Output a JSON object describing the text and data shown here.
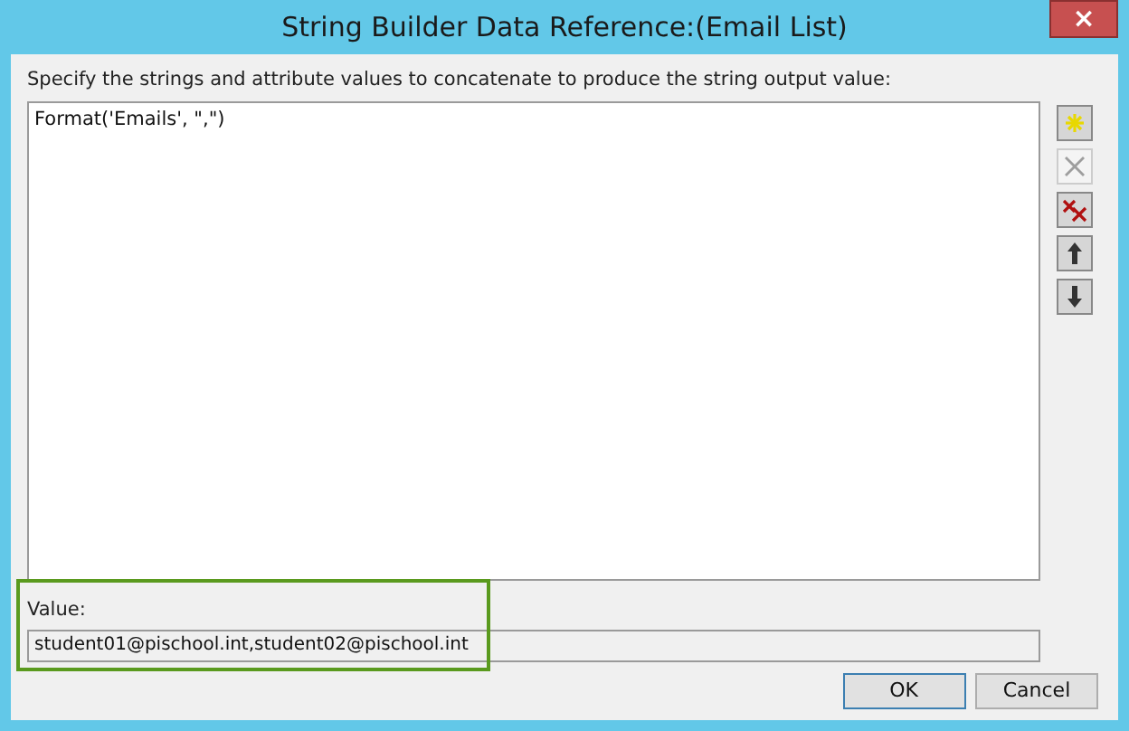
{
  "window": {
    "title": "String Builder Data Reference:(Email List)",
    "close": "×"
  },
  "instruction": "Specify the strings and attribute values to concatenate to produce the string output value:",
  "expression": "Format('Emails', \",\")",
  "tools": [
    {
      "kind": "add",
      "disabled": false
    },
    {
      "kind": "delete",
      "disabled": true
    },
    {
      "kind": "clear",
      "disabled": false
    },
    {
      "kind": "up",
      "disabled": false
    },
    {
      "kind": "down",
      "disabled": false
    }
  ],
  "value_label": "Value:",
  "value": "student01@pischool.int,student02@pischool.int",
  "highlight": {
    "color": "#5a9a1e"
  },
  "buttons": [
    {
      "label": "OK",
      "default": true
    },
    {
      "label": "Cancel",
      "default": false
    }
  ]
}
